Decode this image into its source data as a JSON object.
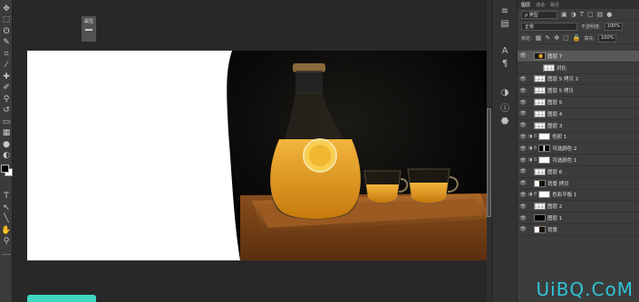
{
  "toolbar": {
    "tools": [
      {
        "name": "move-icon",
        "glyph": "✥"
      },
      {
        "name": "marquee-icon",
        "glyph": "⬚"
      },
      {
        "name": "lasso-icon",
        "glyph": "ʘ"
      },
      {
        "name": "quick-select-icon",
        "glyph": "✎"
      },
      {
        "name": "crop-icon",
        "glyph": "⌗"
      },
      {
        "name": "eyedropper-icon",
        "glyph": "⁄"
      },
      {
        "name": "healing-icon",
        "glyph": "✚"
      },
      {
        "name": "brush-icon",
        "glyph": "✐"
      },
      {
        "name": "stamp-icon",
        "glyph": "⚲"
      },
      {
        "name": "history-brush-icon",
        "glyph": "↺"
      },
      {
        "name": "eraser-icon",
        "glyph": "▭"
      },
      {
        "name": "gradient-icon",
        "glyph": "▦"
      },
      {
        "name": "blur-icon",
        "glyph": "●"
      },
      {
        "name": "dodge-icon",
        "glyph": "◐"
      },
      {
        "name": "pen-icon",
        "glyph": "✒"
      },
      {
        "name": "type-icon",
        "glyph": "T"
      },
      {
        "name": "path-select-icon",
        "glyph": "↖"
      },
      {
        "name": "shape-icon",
        "glyph": "╲"
      },
      {
        "name": "hand-icon",
        "glyph": "✋"
      },
      {
        "name": "zoom-icon",
        "glyph": "⚲"
      },
      {
        "name": "more-tools-icon",
        "glyph": "…"
      }
    ]
  },
  "mini_panel": {
    "label": "属性"
  },
  "layers_panel": {
    "tabs": [
      "图层",
      "通道",
      "路径"
    ],
    "filter_kind": "ρ 类型",
    "blend_mode": "正常",
    "opacity_label": "不透明度:",
    "opacity_value": "100%",
    "lock_label": "锁定:",
    "fill_label": "填充:",
    "fill_value": "100%",
    "layers": [
      {
        "name": "图层 7",
        "visible": true,
        "selected": true,
        "thumb": "photo2",
        "link": false,
        "adj": ""
      },
      {
        "name": "对比",
        "visible": false,
        "selected": false,
        "thumb": "checker",
        "link": false,
        "adj": "",
        "indent": true
      },
      {
        "name": "图层 5 拷贝 2",
        "visible": true,
        "selected": false,
        "thumb": "checker",
        "link": false,
        "adj": ""
      },
      {
        "name": "图层 5 拷贝",
        "visible": true,
        "selected": false,
        "thumb": "checker",
        "link": false,
        "adj": ""
      },
      {
        "name": "图层 5",
        "visible": true,
        "selected": false,
        "thumb": "checker",
        "link": false,
        "adj": ""
      },
      {
        "name": "图层 4",
        "visible": true,
        "selected": false,
        "thumb": "checker",
        "link": false,
        "adj": ""
      },
      {
        "name": "图层 3",
        "visible": true,
        "selected": false,
        "thumb": "checker",
        "link": false,
        "adj": ""
      },
      {
        "name": "色阶 1",
        "visible": true,
        "selected": false,
        "thumb": "white",
        "link": true,
        "adj": "◑"
      },
      {
        "name": "可选颜色 2",
        "visible": true,
        "selected": false,
        "thumb": "maskdark",
        "link": true,
        "adj": "◑"
      },
      {
        "name": "可选颜色 1",
        "visible": true,
        "selected": false,
        "thumb": "white",
        "link": true,
        "adj": "◑"
      },
      {
        "name": "图层 6",
        "visible": true,
        "selected": false,
        "thumb": "checker",
        "link": false,
        "adj": ""
      },
      {
        "name": "背景 拷贝",
        "visible": true,
        "selected": false,
        "thumb": "photo",
        "link": false,
        "adj": ""
      },
      {
        "name": "色彩平衡 1",
        "visible": true,
        "selected": false,
        "thumb": "white",
        "link": true,
        "adj": "◑"
      },
      {
        "name": "图层 2",
        "visible": true,
        "selected": false,
        "thumb": "checker",
        "link": false,
        "adj": ""
      },
      {
        "name": "图层 1",
        "visible": true,
        "selected": false,
        "thumb": "black",
        "link": false,
        "adj": ""
      },
      {
        "name": "背景",
        "visible": true,
        "selected": false,
        "thumb": "photo",
        "link": false,
        "adj": ""
      }
    ]
  },
  "watermark": {
    "text": "UiBQ.CoM"
  },
  "colors": {
    "accent_teal": "#3fd6c2",
    "panel": "#3c3c3c",
    "workspace": "#282828"
  }
}
